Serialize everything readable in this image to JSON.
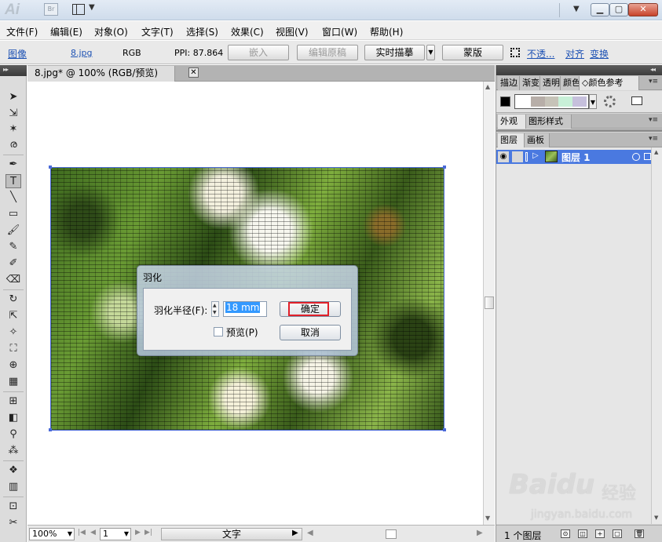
{
  "titlebar": {
    "app_logo": "Ai",
    "bridge_label": "Br",
    "icons": [
      "workspace-icon",
      "minimize-icon",
      "maximize-icon",
      "close-icon"
    ]
  },
  "menu": [
    "文件(F)",
    "编辑(E)",
    "对象(O)",
    "文字(T)",
    "选择(S)",
    "效果(C)",
    "视图(V)",
    "窗口(W)",
    "帮助(H)"
  ],
  "control": {
    "object_type": "图像",
    "filename": "8.jpg",
    "color_mode": "RGB",
    "ppi": "PPI: 87.864",
    "embed": "嵌入",
    "edit_original": "编辑原稿",
    "live_trace": "实时描摹",
    "mask": "蒙版",
    "opacity": "不透...",
    "align": "对齐",
    "transform": "变换"
  },
  "document": {
    "tab_title": "8.jpg* @ 100% (RGB/预览)"
  },
  "dialog": {
    "title": "羽化",
    "radius_label": "羽化半径(F):",
    "radius_value": "18 mm",
    "preview_label": "预览(P)",
    "preview_checked": false,
    "ok": "确定",
    "cancel": "取消"
  },
  "status": {
    "zoom": "100%",
    "artboard": "1",
    "tool_name": "文字"
  },
  "panels": {
    "group1_tabs": [
      "描边",
      "渐变",
      "透明",
      "颜色",
      "颜色参考"
    ],
    "group2_tabs": [
      "外观",
      "图形样式"
    ],
    "group3_tabs": [
      "图层",
      "画板"
    ],
    "swatch_colors": [
      "#ffffff",
      "#b7aea8",
      "#c6c3b8",
      "#c8f0d8",
      "#c6c0dc"
    ],
    "layer_name": "图层 1",
    "layer_count": "1 个图层"
  },
  "watermark": {
    "logo": "Baidu",
    "brand": "经验",
    "url": "jingyan.baidu.com"
  }
}
